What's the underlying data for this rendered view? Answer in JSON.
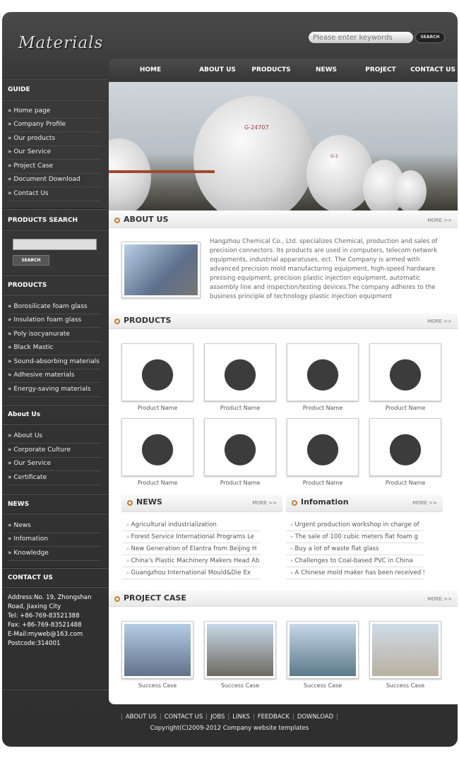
{
  "header": {
    "logo": "Materials",
    "search_placeholder": "Please enter keywords",
    "search_button": "SEARCH"
  },
  "nav": [
    "HOME",
    "ABOUT US",
    "PRODUCTS",
    "NEWS",
    "PROJECT",
    "CONTACT US"
  ],
  "sidebar": {
    "guide": {
      "title": "GUIDE",
      "items": [
        "Home page",
        "Company Profile",
        "Our products",
        "Our Service",
        "Project Case",
        "Document Download",
        "Contact Us"
      ]
    },
    "search": {
      "title": "PRODUCTS SEARCH",
      "button": "SEARCH"
    },
    "products": {
      "title": "PRODUCTS",
      "items": [
        "Borosilicate foam glass",
        "Insulation foam glass",
        "Poly isocyanurate",
        "Black Mastic",
        "Sound-absorbing materials",
        "Adhesive materials",
        "Energy-saving materials"
      ]
    },
    "about": {
      "title": "About Us",
      "items": [
        "About Us",
        "Corporate Culture",
        "Our Service",
        "Certificate"
      ]
    },
    "news": {
      "title": "NEWS",
      "items": [
        "News",
        "Infomation",
        "Knowledge"
      ]
    },
    "contact": {
      "title": "CONTACT US",
      "lines": [
        "Address:No. 19, Zhongshan Road, Jiaxing City",
        "Tel: +86-769-83521388",
        "Fax: +86-769-83521488",
        "E-Mail:myweb@163.com",
        "Postcode:314001"
      ]
    }
  },
  "hero": {
    "tank_label_1": "G-24707",
    "tank_label_2": "G-2"
  },
  "about": {
    "title": "ABOUT US",
    "more": "MORE >>",
    "text": "Hangzhou Chemical Co., Ltd. specializes Chemical, production and sales of precision connectors. Its products are used in computers, telecom network equipments, industrial apparatuses, ect. The Company is armed with advanced precision mold manufacturing equipment, high-speed hardware pressing equipment, precision plastic injection equipment, automatic assembly line and inspection/testing devices.The company adheres to the business principle of technology plastic injection equipment"
  },
  "products": {
    "title": "PRODUCTS",
    "more": "MORE >>",
    "items": [
      "Product Name",
      "Product Name",
      "Product Name",
      "Product Name",
      "Product Name",
      "Product Name",
      "Product Name",
      "Product Name"
    ]
  },
  "news": {
    "title": "NEWS",
    "more": "MORE >>",
    "items": [
      "Agricultural industrialization",
      "Forest Service International Programs Le",
      "New Generation of Elantra from Beijing H",
      "China's Plastic Machinery Makers Head Ab",
      "Guangzhou International Mould&Die Ex"
    ]
  },
  "info": {
    "title": "Infomation",
    "more": "MORE >>",
    "items": [
      "Urgent production workshop in charge of",
      "The sale of 100 cubic meters flat foam g",
      "Buy a lot of waste flat glass",
      "Challenges to Coal-based PVC in China",
      "A Chinese mold maker has been received S"
    ]
  },
  "project": {
    "title": "PROJECT CASE",
    "more": "MORE >>",
    "items": [
      "Success Case",
      "Success Case",
      "Success Case",
      "Success Case"
    ]
  },
  "footer": {
    "links": [
      "ABOUT US",
      "CONTACT US",
      "JOBS",
      "LINKS",
      "FEEDBACK",
      "DOWNLOAD"
    ],
    "copyright": "Copyright(C)2009-2012  Company website templates"
  }
}
